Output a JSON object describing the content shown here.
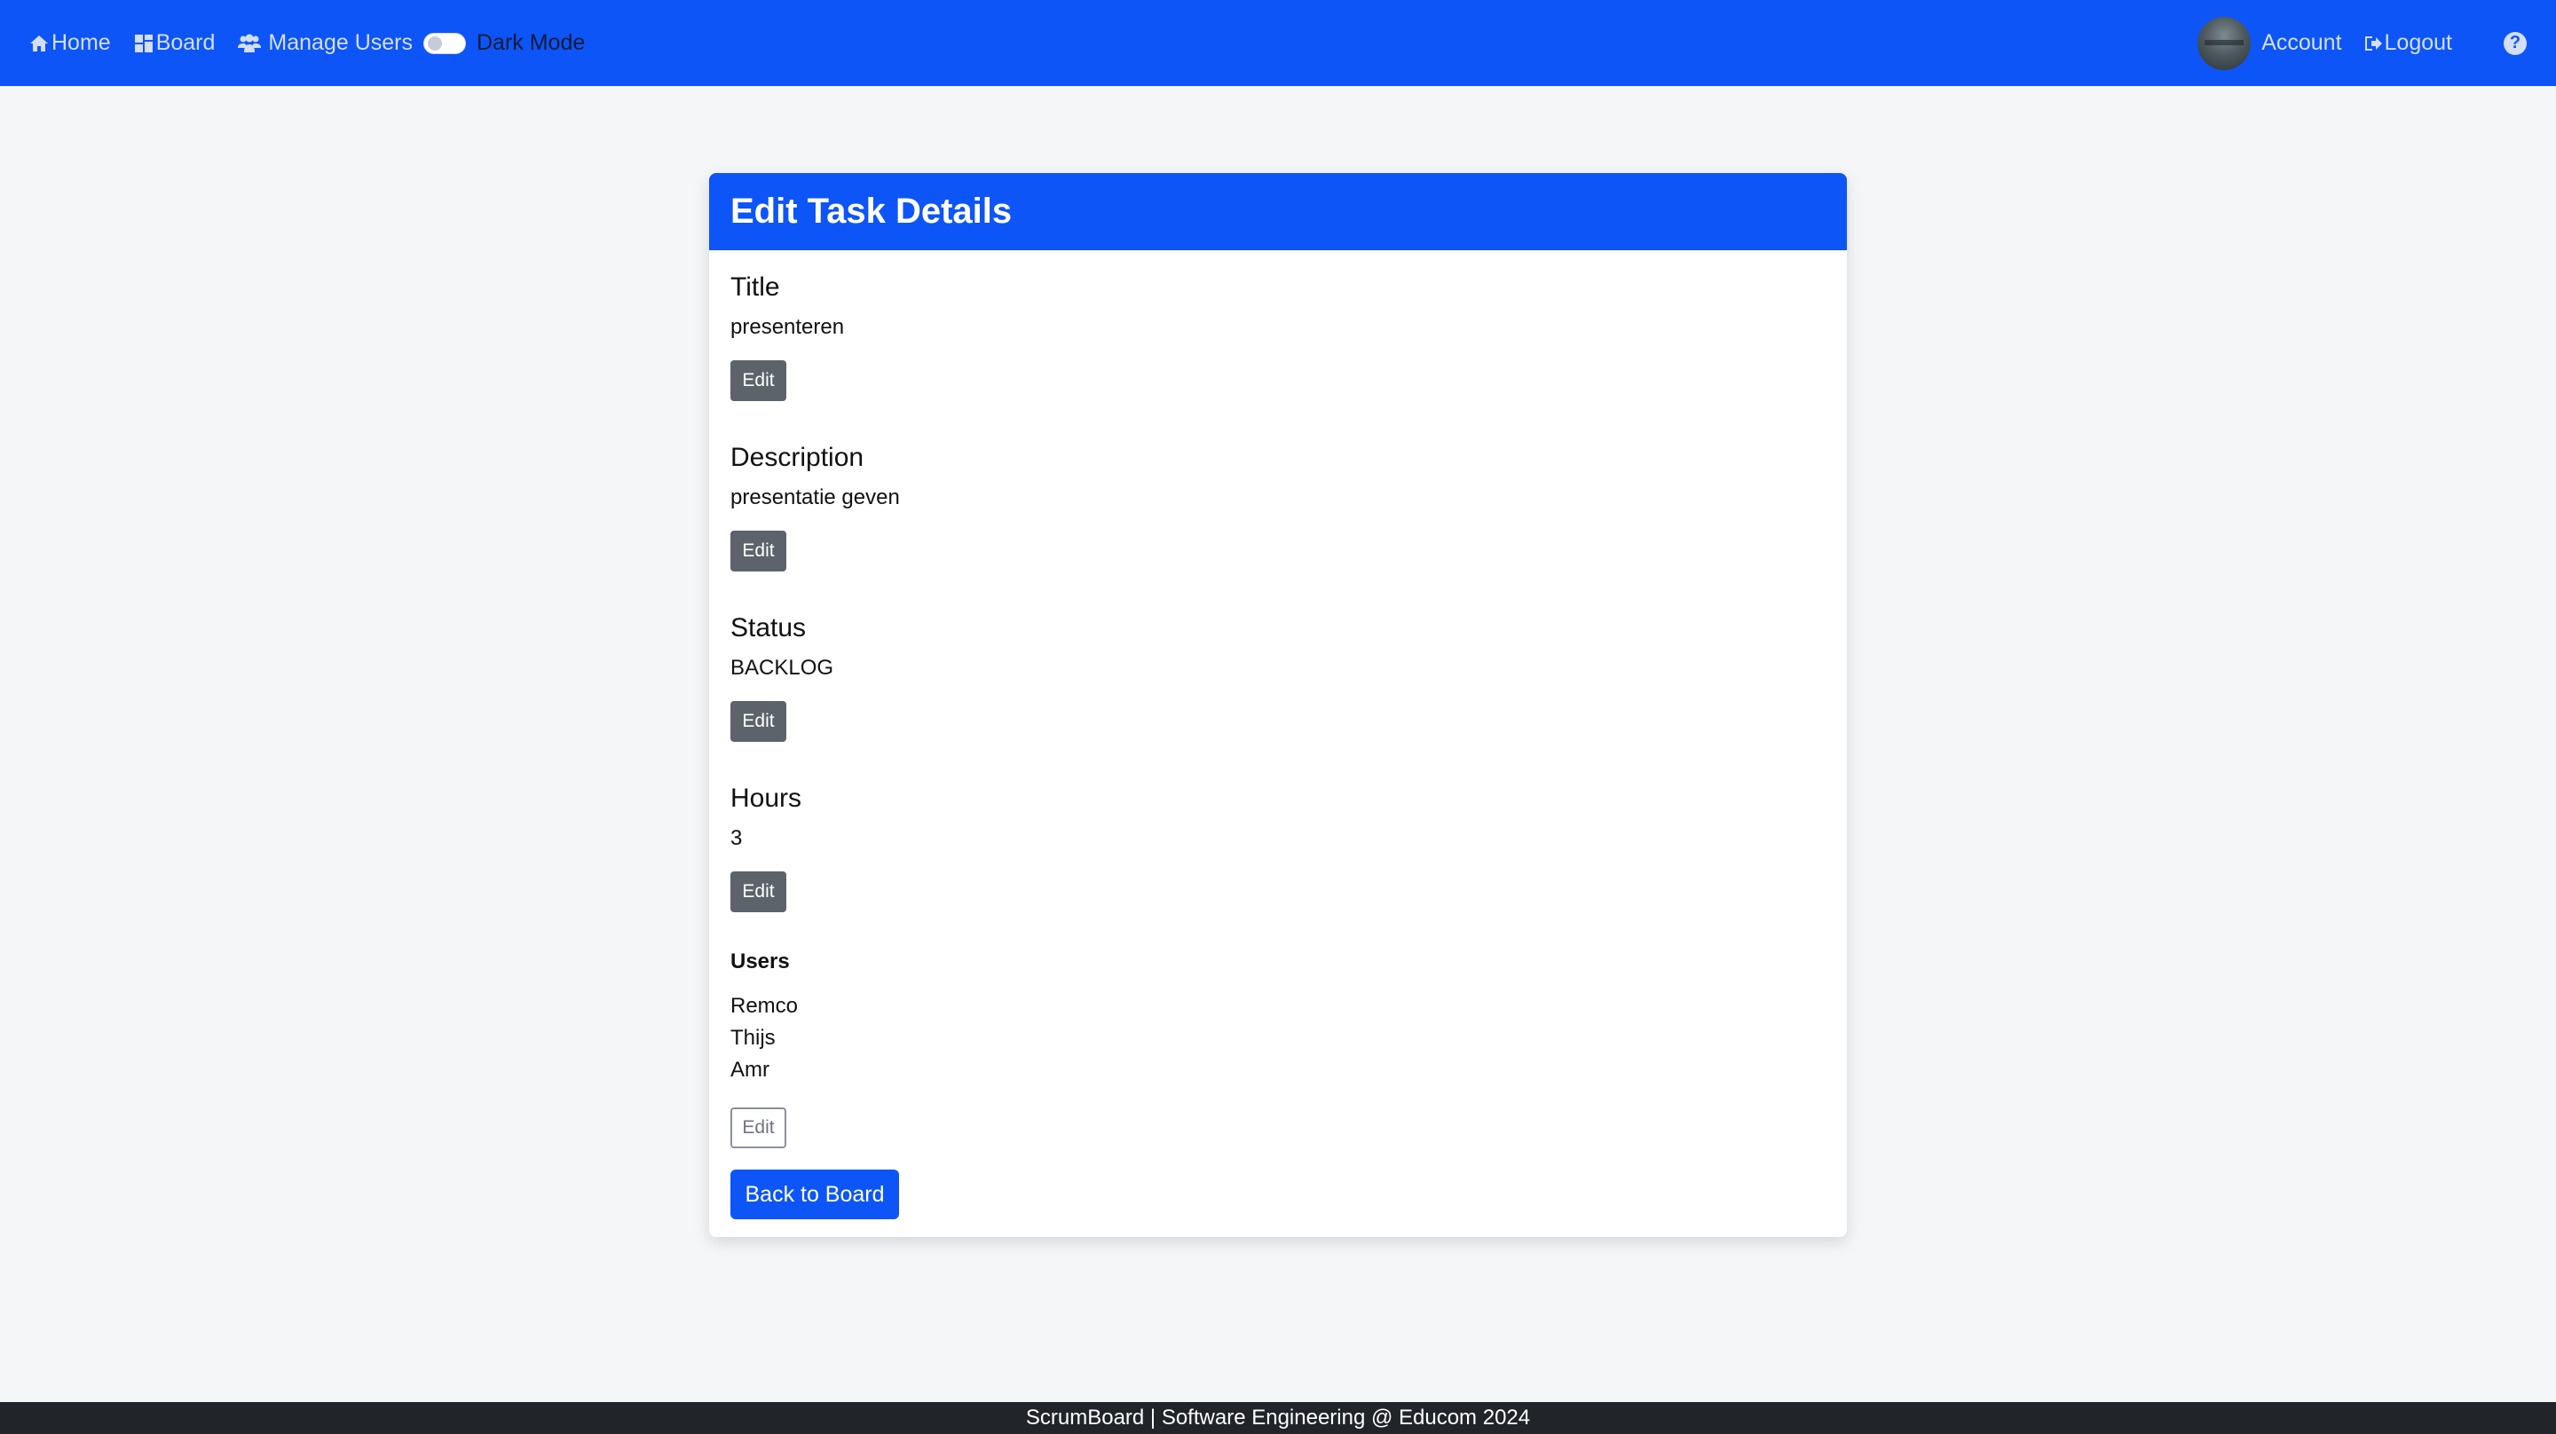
{
  "colors": {
    "primary": "#0d55f6",
    "secondary_button": "#5c636a",
    "page_background": "#f4f6f8",
    "footer_background": "#212529"
  },
  "navbar": {
    "home_label": "Home",
    "home_icon": "home-icon",
    "board_label": "Board",
    "board_icon": "grid-icon",
    "manage_users_label": "Manage Users",
    "manage_users_icon": "users-icon",
    "dark_mode_label": "Dark Mode",
    "dark_mode_on": false,
    "account_label": "Account",
    "logout_label": "Logout",
    "logout_icon": "logout-icon",
    "help_icon": "question-circle-icon"
  },
  "card": {
    "title": "Edit Task Details",
    "fields": {
      "title": {
        "heading": "Title",
        "value": "presenteren",
        "edit_label": "Edit"
      },
      "description": {
        "heading": "Description",
        "value": "presentatie geven",
        "edit_label": "Edit"
      },
      "status": {
        "heading": "Status",
        "value": "BACKLOG",
        "edit_label": "Edit"
      },
      "hours": {
        "heading": "Hours",
        "value": "3",
        "edit_label": "Edit"
      }
    },
    "users": {
      "heading": "Users",
      "list": [
        "Remco",
        "Thijs",
        "Amr"
      ],
      "edit_label": "Edit"
    },
    "back_button_label": "Back to Board"
  },
  "footer": {
    "text": "ScrumBoard | Software Engineering @ Educom 2024"
  }
}
